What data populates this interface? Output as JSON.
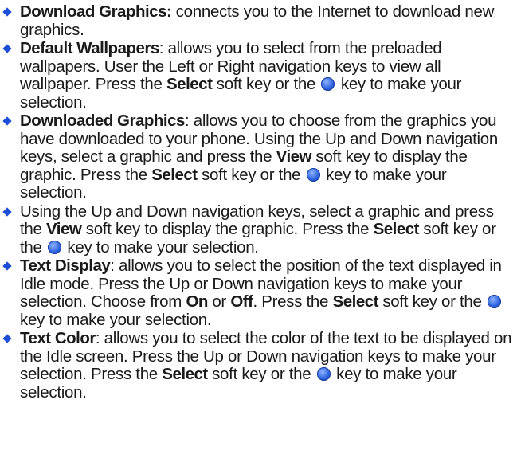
{
  "colors": {
    "accent": "#1f4fd8",
    "text": "#1a1a1a",
    "key": "#2e63e0"
  },
  "items": [
    {
      "segments": [
        {
          "t": "Download Graphics:",
          "b": true
        },
        {
          "t": " connects you to the Internet to download new graphics."
        }
      ]
    },
    {
      "segments": [
        {
          "t": "Default Wallpapers",
          "b": true
        },
        {
          "t": ": allows you to select from the preloaded wallpapers. User the Left or Right navigation keys to view all wallpaper. Press the "
        },
        {
          "t": "Select",
          "b": true
        },
        {
          "t": " soft key or the "
        },
        {
          "icon": "select-key-icon"
        },
        {
          "t": " key to make your selection."
        }
      ]
    },
    {
      "segments": [
        {
          "t": "Downloaded Graphics",
          "b": true
        },
        {
          "t": ": allows you to choose from the graphics you have downloaded to your phone. Using the Up and Down navigation keys, select a graphic and press the "
        },
        {
          "t": "View",
          "b": true
        },
        {
          "t": " soft key to display the graphic. Press the "
        },
        {
          "t": "Select",
          "b": true
        },
        {
          "t": " soft key or the "
        },
        {
          "icon": "select-key-icon"
        },
        {
          "t": " key to make your selection."
        }
      ]
    },
    {
      "segments": [
        {
          "t": "Using the Up and Down navigation keys, select a graphic and press the "
        },
        {
          "t": "View",
          "b": true
        },
        {
          "t": " soft key to display the graphic. Press the "
        },
        {
          "t": "Select",
          "b": true
        },
        {
          "t": " soft key or the "
        },
        {
          "icon": "select-key-icon"
        },
        {
          "t": " key to make your selection."
        }
      ]
    },
    {
      "segments": [
        {
          "t": "Text Display",
          "b": true
        },
        {
          "t": ": allows you to select the position of the text displayed in Idle mode. Press the Up or Down navigation keys to make your selection. Choose from "
        },
        {
          "t": "On",
          "b": true
        },
        {
          "t": " or "
        },
        {
          "t": "Off",
          "b": true
        },
        {
          "t": ". Press the "
        },
        {
          "t": "Select",
          "b": true
        },
        {
          "t": " soft key or the "
        },
        {
          "icon": "select-key-icon"
        },
        {
          "t": " key to make your selection."
        }
      ]
    },
    {
      "segments": [
        {
          "t": "Text Color",
          "b": true
        },
        {
          "t": ": allows you to select the color of the text to be displayed on the Idle screen. Press the Up or Down navigation keys to make your selection. Press the "
        },
        {
          "t": "Select",
          "b": true
        },
        {
          "t": " soft key or the "
        },
        {
          "icon": "select-key-icon"
        },
        {
          "t": " key to make your selection."
        }
      ]
    }
  ]
}
